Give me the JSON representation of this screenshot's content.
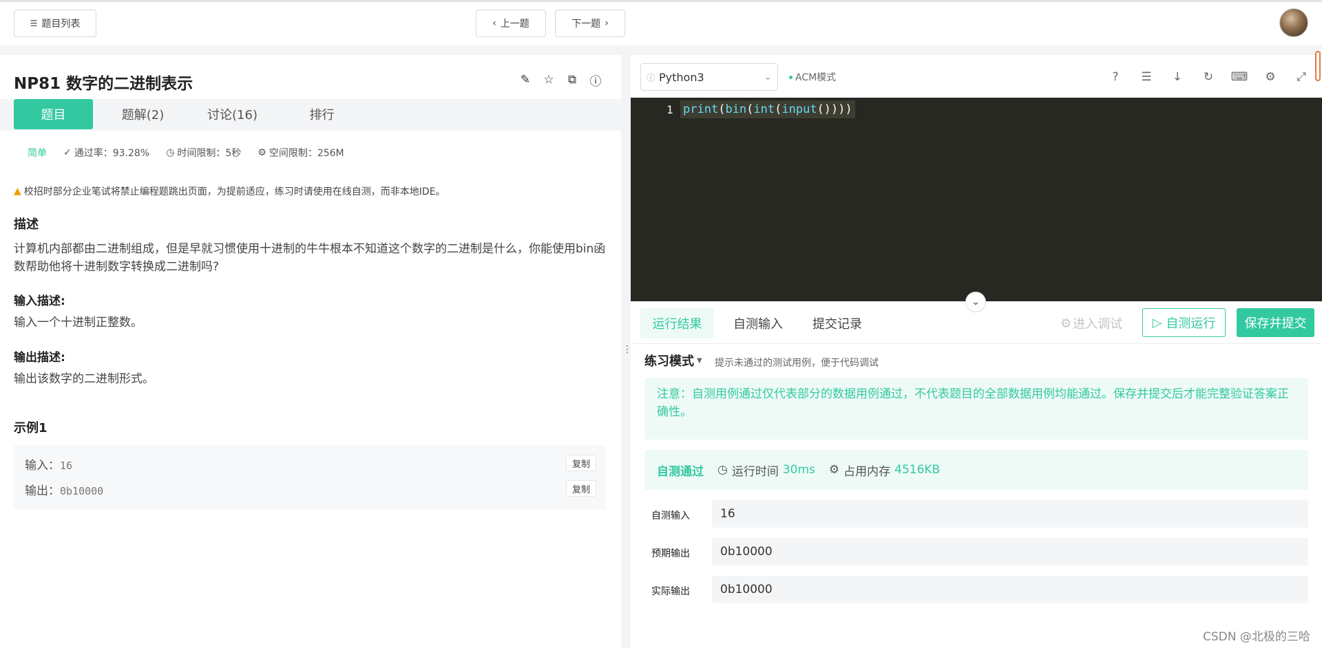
{
  "topbar": {
    "problem_list": "题目列表",
    "prev": "上一题",
    "next": "下一题"
  },
  "problem": {
    "title": "NP81  数字的二进制表示",
    "tabs": [
      "题目",
      "题解(2)",
      "讨论(16)",
      "排行"
    ],
    "difficulty": "简单",
    "pass_rate": "通过率：93.28%",
    "time_limit": "时间限制：5秒",
    "space_limit": "空间限制：256M",
    "notice": "校招时部分企业笔试将禁止编程题跳出页面，为提前适应，练习时请使用在线自测，而非本地IDE。",
    "desc_heading": "描述",
    "desc": "计算机内部都由二进制组成，但是早就习惯使用十进制的牛牛根本不知道这个数字的二进制是什么，你能使用bin函数帮助他将十进制数字转换成二进制吗?",
    "input_heading": "输入描述:",
    "input_desc": "输入一个十进制正整数。",
    "output_heading": "输出描述:",
    "output_desc": "输出该数字的二进制形式。",
    "example_heading": "示例1",
    "example": {
      "input_label": "输入：",
      "input_value": "16",
      "output_label": "输出：",
      "output_value": "0b10000",
      "copy": "复制"
    }
  },
  "editor": {
    "language": "Python3",
    "mode": "ACM模式",
    "line_number": "1",
    "code_tokens": [
      "print",
      "(",
      "bin",
      "(",
      "int",
      "(",
      "input",
      "())))"
    ]
  },
  "result": {
    "tabs": [
      "运行结果",
      "自测输入",
      "提交记录"
    ],
    "debug": "进入调试",
    "run": "自测运行",
    "submit": "保存并提交",
    "mode_label": "练习模式",
    "mode_hint": "提示未通过的测试用例，便于代码调试",
    "note": "注意：自测用例通过仅代表部分的数据用例通过，不代表题目的全部数据用例均能通过。保存并提交后才能完整验证答案正确性。",
    "status": "自测通过",
    "runtime_label": "运行时间",
    "runtime_value": "30ms",
    "memory_label": "占用内存",
    "memory_value": "4516KB",
    "self_input_label": "自测输入",
    "self_input_value": "16",
    "expected_label": "预期输出",
    "expected_value": "0b10000",
    "actual_label": "实际输出",
    "actual_value": "0b10000"
  },
  "watermark": "CSDN @北极的三哈",
  "colors": {
    "accent": "#32c9a0",
    "editor_bg": "#272822"
  }
}
